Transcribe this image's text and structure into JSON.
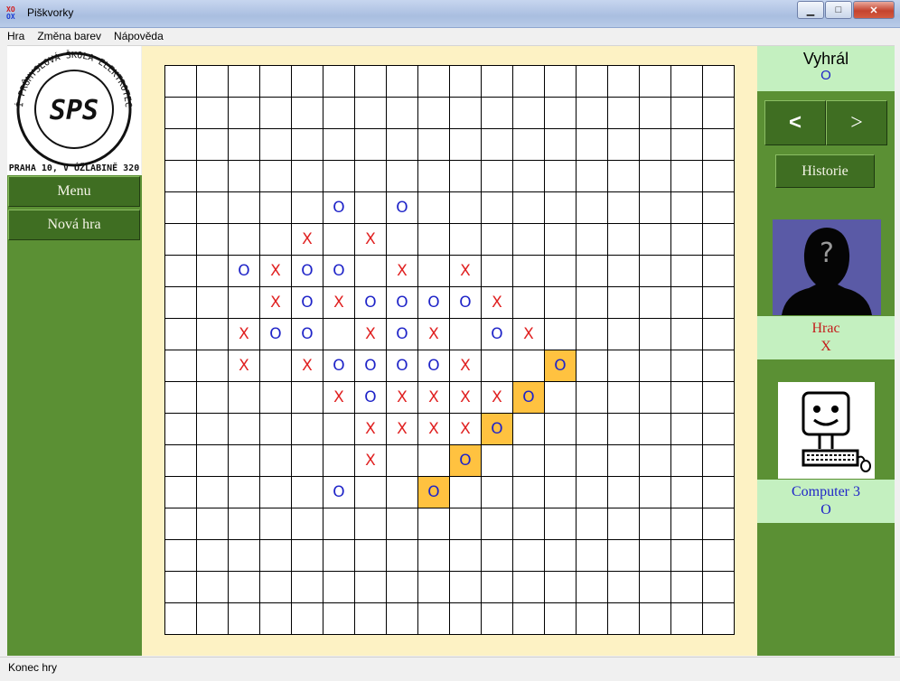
{
  "window": {
    "title": "Piškvorky",
    "icon": "xo-app-icon",
    "icon_text_top": "XO",
    "icon_text_bottom": "OX"
  },
  "menu": [
    "Hra",
    "Změna barev",
    "Nápověda"
  ],
  "left": {
    "logo": {
      "letters": "SPS",
      "ring_text": "STŘEDNÍ PRŮMYSLOVÁ ŠKOLA ELEKTROTECHNICKÁ",
      "address": "PRAHA 10, V ÚŽLABINĚ 320"
    },
    "menu_button": "Menu",
    "new_game_button": "Nová hra"
  },
  "board": {
    "size": 18,
    "cells": [
      {
        "r": 4,
        "c": 5,
        "v": "O"
      },
      {
        "r": 4,
        "c": 7,
        "v": "O"
      },
      {
        "r": 5,
        "c": 4,
        "v": "X"
      },
      {
        "r": 5,
        "c": 6,
        "v": "X"
      },
      {
        "r": 6,
        "c": 2,
        "v": "O"
      },
      {
        "r": 6,
        "c": 3,
        "v": "X"
      },
      {
        "r": 6,
        "c": 4,
        "v": "O"
      },
      {
        "r": 6,
        "c": 5,
        "v": "O"
      },
      {
        "r": 6,
        "c": 7,
        "v": "X"
      },
      {
        "r": 6,
        "c": 9,
        "v": "X"
      },
      {
        "r": 7,
        "c": 3,
        "v": "X"
      },
      {
        "r": 7,
        "c": 4,
        "v": "O"
      },
      {
        "r": 7,
        "c": 5,
        "v": "X"
      },
      {
        "r": 7,
        "c": 6,
        "v": "O"
      },
      {
        "r": 7,
        "c": 7,
        "v": "O"
      },
      {
        "r": 7,
        "c": 8,
        "v": "O"
      },
      {
        "r": 7,
        "c": 9,
        "v": "O"
      },
      {
        "r": 7,
        "c": 10,
        "v": "X"
      },
      {
        "r": 8,
        "c": 2,
        "v": "X"
      },
      {
        "r": 8,
        "c": 3,
        "v": "O"
      },
      {
        "r": 8,
        "c": 4,
        "v": "O"
      },
      {
        "r": 8,
        "c": 6,
        "v": "X"
      },
      {
        "r": 8,
        "c": 7,
        "v": "O"
      },
      {
        "r": 8,
        "c": 8,
        "v": "X"
      },
      {
        "r": 8,
        "c": 10,
        "v": "O"
      },
      {
        "r": 8,
        "c": 11,
        "v": "X"
      },
      {
        "r": 9,
        "c": 2,
        "v": "X"
      },
      {
        "r": 9,
        "c": 4,
        "v": "X"
      },
      {
        "r": 9,
        "c": 5,
        "v": "O"
      },
      {
        "r": 9,
        "c": 6,
        "v": "O"
      },
      {
        "r": 9,
        "c": 7,
        "v": "O"
      },
      {
        "r": 9,
        "c": 8,
        "v": "O"
      },
      {
        "r": 9,
        "c": 9,
        "v": "X"
      },
      {
        "r": 9,
        "c": 12,
        "v": "O",
        "win": true
      },
      {
        "r": 10,
        "c": 5,
        "v": "X"
      },
      {
        "r": 10,
        "c": 6,
        "v": "O"
      },
      {
        "r": 10,
        "c": 7,
        "v": "X"
      },
      {
        "r": 10,
        "c": 8,
        "v": "X"
      },
      {
        "r": 10,
        "c": 9,
        "v": "X"
      },
      {
        "r": 10,
        "c": 10,
        "v": "X"
      },
      {
        "r": 10,
        "c": 11,
        "v": "O",
        "win": true
      },
      {
        "r": 11,
        "c": 6,
        "v": "X"
      },
      {
        "r": 11,
        "c": 7,
        "v": "X"
      },
      {
        "r": 11,
        "c": 8,
        "v": "X"
      },
      {
        "r": 11,
        "c": 9,
        "v": "X"
      },
      {
        "r": 11,
        "c": 10,
        "v": "O",
        "win": true
      },
      {
        "r": 12,
        "c": 6,
        "v": "X"
      },
      {
        "r": 12,
        "c": 9,
        "v": "O",
        "win": true
      },
      {
        "r": 13,
        "c": 5,
        "v": "O"
      },
      {
        "r": 13,
        "c": 8,
        "v": "O",
        "win": true
      }
    ]
  },
  "right": {
    "winner_label": "Vyhrál",
    "winner_symbol": "O",
    "prev_button": "<",
    "next_button": ">",
    "history_button": "Historie",
    "player1": {
      "name": "Hrac",
      "symbol": "X",
      "avatar": "unknown-person-avatar",
      "avatar_glyph": "?"
    },
    "player2": {
      "name": "Computer 3",
      "symbol": "O",
      "avatar": "computer-avatar"
    }
  },
  "colors": {
    "x": "#e02020",
    "o": "#1f24c8",
    "win_highlight": "#ffc240",
    "panel_green": "#5b9034",
    "button_green": "#3f6e22",
    "info_green": "#c4f0c0"
  },
  "status": "Konec hry"
}
